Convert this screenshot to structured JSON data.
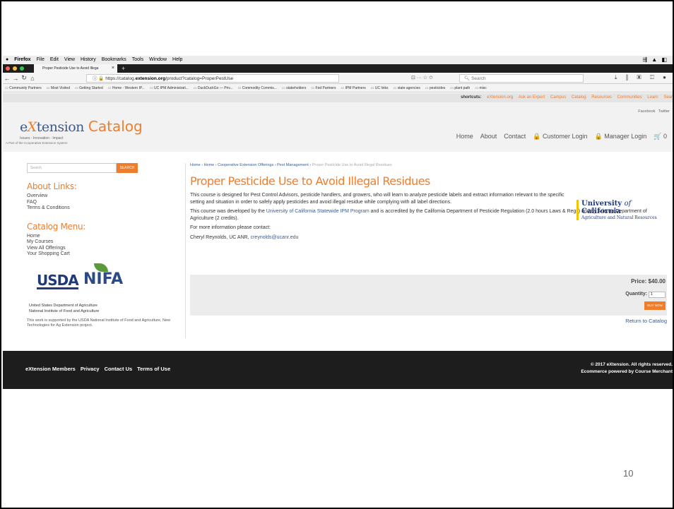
{
  "mac_menu": {
    "app": "Firefox",
    "items": [
      "File",
      "Edit",
      "View",
      "History",
      "Bookmarks",
      "Tools",
      "Window",
      "Help"
    ],
    "right": "⇶ ▲ ◧"
  },
  "tab": {
    "title": "Proper Pesticide Use to Avoid Illega",
    "new": "+"
  },
  "address": {
    "prefix": "https://catalog.",
    "domain": "extension.org",
    "path": "/product?catalog=ProperPestUse"
  },
  "search_placeholder": "Search",
  "url_tools": "⊡  ···  ☆  ✩",
  "right_tools": "⤓ ⫼ ▣ ◫ ●",
  "bookmarks": [
    "Community Partners",
    "Most Visited",
    "Getting Started",
    "Home - Western IP...",
    "UC IPM Administrati...",
    "DuckDuckGo — Priv...",
    "Commodity Commis...",
    "stakeholders",
    "Fed Partners",
    "IPM Partners",
    "UC links",
    "state agencies",
    "pesticides",
    "plant path",
    "misc"
  ],
  "shortcuts": {
    "label": "shortcuts:",
    "links": [
      "eXtension.org",
      "Ask an Expert",
      "Campus",
      "Catalog",
      "Resources",
      "Communities",
      "Learn",
      "Sear"
    ]
  },
  "header": {
    "social": "Facebook Twitter",
    "logo_e": "e",
    "logo_x": "X",
    "logo_rest": "tension",
    "logo_catalog": "Catalog",
    "logo_tag": "Issues - Innovation - Impact",
    "logo_sub": "A Part of the Cooperative Extension System",
    "nav": [
      "Home",
      "About",
      "Contact",
      "🔒 Customer Login",
      "🔒 Manager Login",
      "🛒 0"
    ]
  },
  "sidebar": {
    "search_placeholder": "Search",
    "search_btn": "SEARCH",
    "about_heading": "About Links:",
    "about_links": [
      "Overview",
      "FAQ",
      "Terms & Conditions"
    ],
    "catalog_heading": "Catalog Menu:",
    "catalog_links": [
      "Home",
      "My Courses",
      "View All Offerings",
      "Your Shopping Cart"
    ],
    "usda": "USDA",
    "nifa": "NIFA",
    "usda_line1": "United States Department of Agriculture",
    "usda_line2": "National Institute of Food and Agriculture",
    "support": "This work is supported by the USDA National Institute of Food and Agriculture, New Technologies for Ag Extension project."
  },
  "breadcrumbs": {
    "home1": "Home",
    "home2": "Home",
    "offerings": "Cooperative Extension Offerings",
    "pest": "Pest Management",
    "current": "Proper Pesticide Use to Avoid Illegal Residues"
  },
  "main": {
    "title": "Proper Pesticide Use to Avoid Illegal Residues",
    "p1": "This course is designed for Pest Control Advisors, pesticide handlers, and growers, who will learn to analyze pesticide labels and extract information relevant to the specific setting and situation in order to safely apply pesticides and avoid illegal residue while complying with all label directions.",
    "p2_before": "This course was developed by the ",
    "p2_link": "University of California Statewide IPM Program",
    "p2_after": " and is accredited by the California Department of Pesticide Regulation (2.0 hours Laws & Regs) and by Arizona Department of Agriculture (2 credits).",
    "p3": "For more information please contact:",
    "p4_before": "Cheryl Reynolds, UC ANR, ",
    "p4_link": "creynolds@ucanr.edu",
    "uc_line1_a": "University ",
    "uc_line1_of": "of",
    "uc_line1_b": " California",
    "uc_line2": "Agriculture and Natural Resources",
    "price": "Price: $40.00",
    "quantity_label": "Quantity:",
    "quantity_value": "1",
    "buy": "BUY NOW",
    "return": "Return to Catalog"
  },
  "footer": {
    "links": [
      "eXtension Members",
      "Privacy",
      "Contact Us",
      "Terms of Use"
    ],
    "copyright": "© 2017 eXtension. All rights reserved.",
    "powered": "Ecommerce powered by Course Merchant"
  },
  "page_number": "10",
  "colors": {
    "accent": "#ee7d2c",
    "link": "#3d5a8c",
    "footer": "#1d1d1d"
  }
}
